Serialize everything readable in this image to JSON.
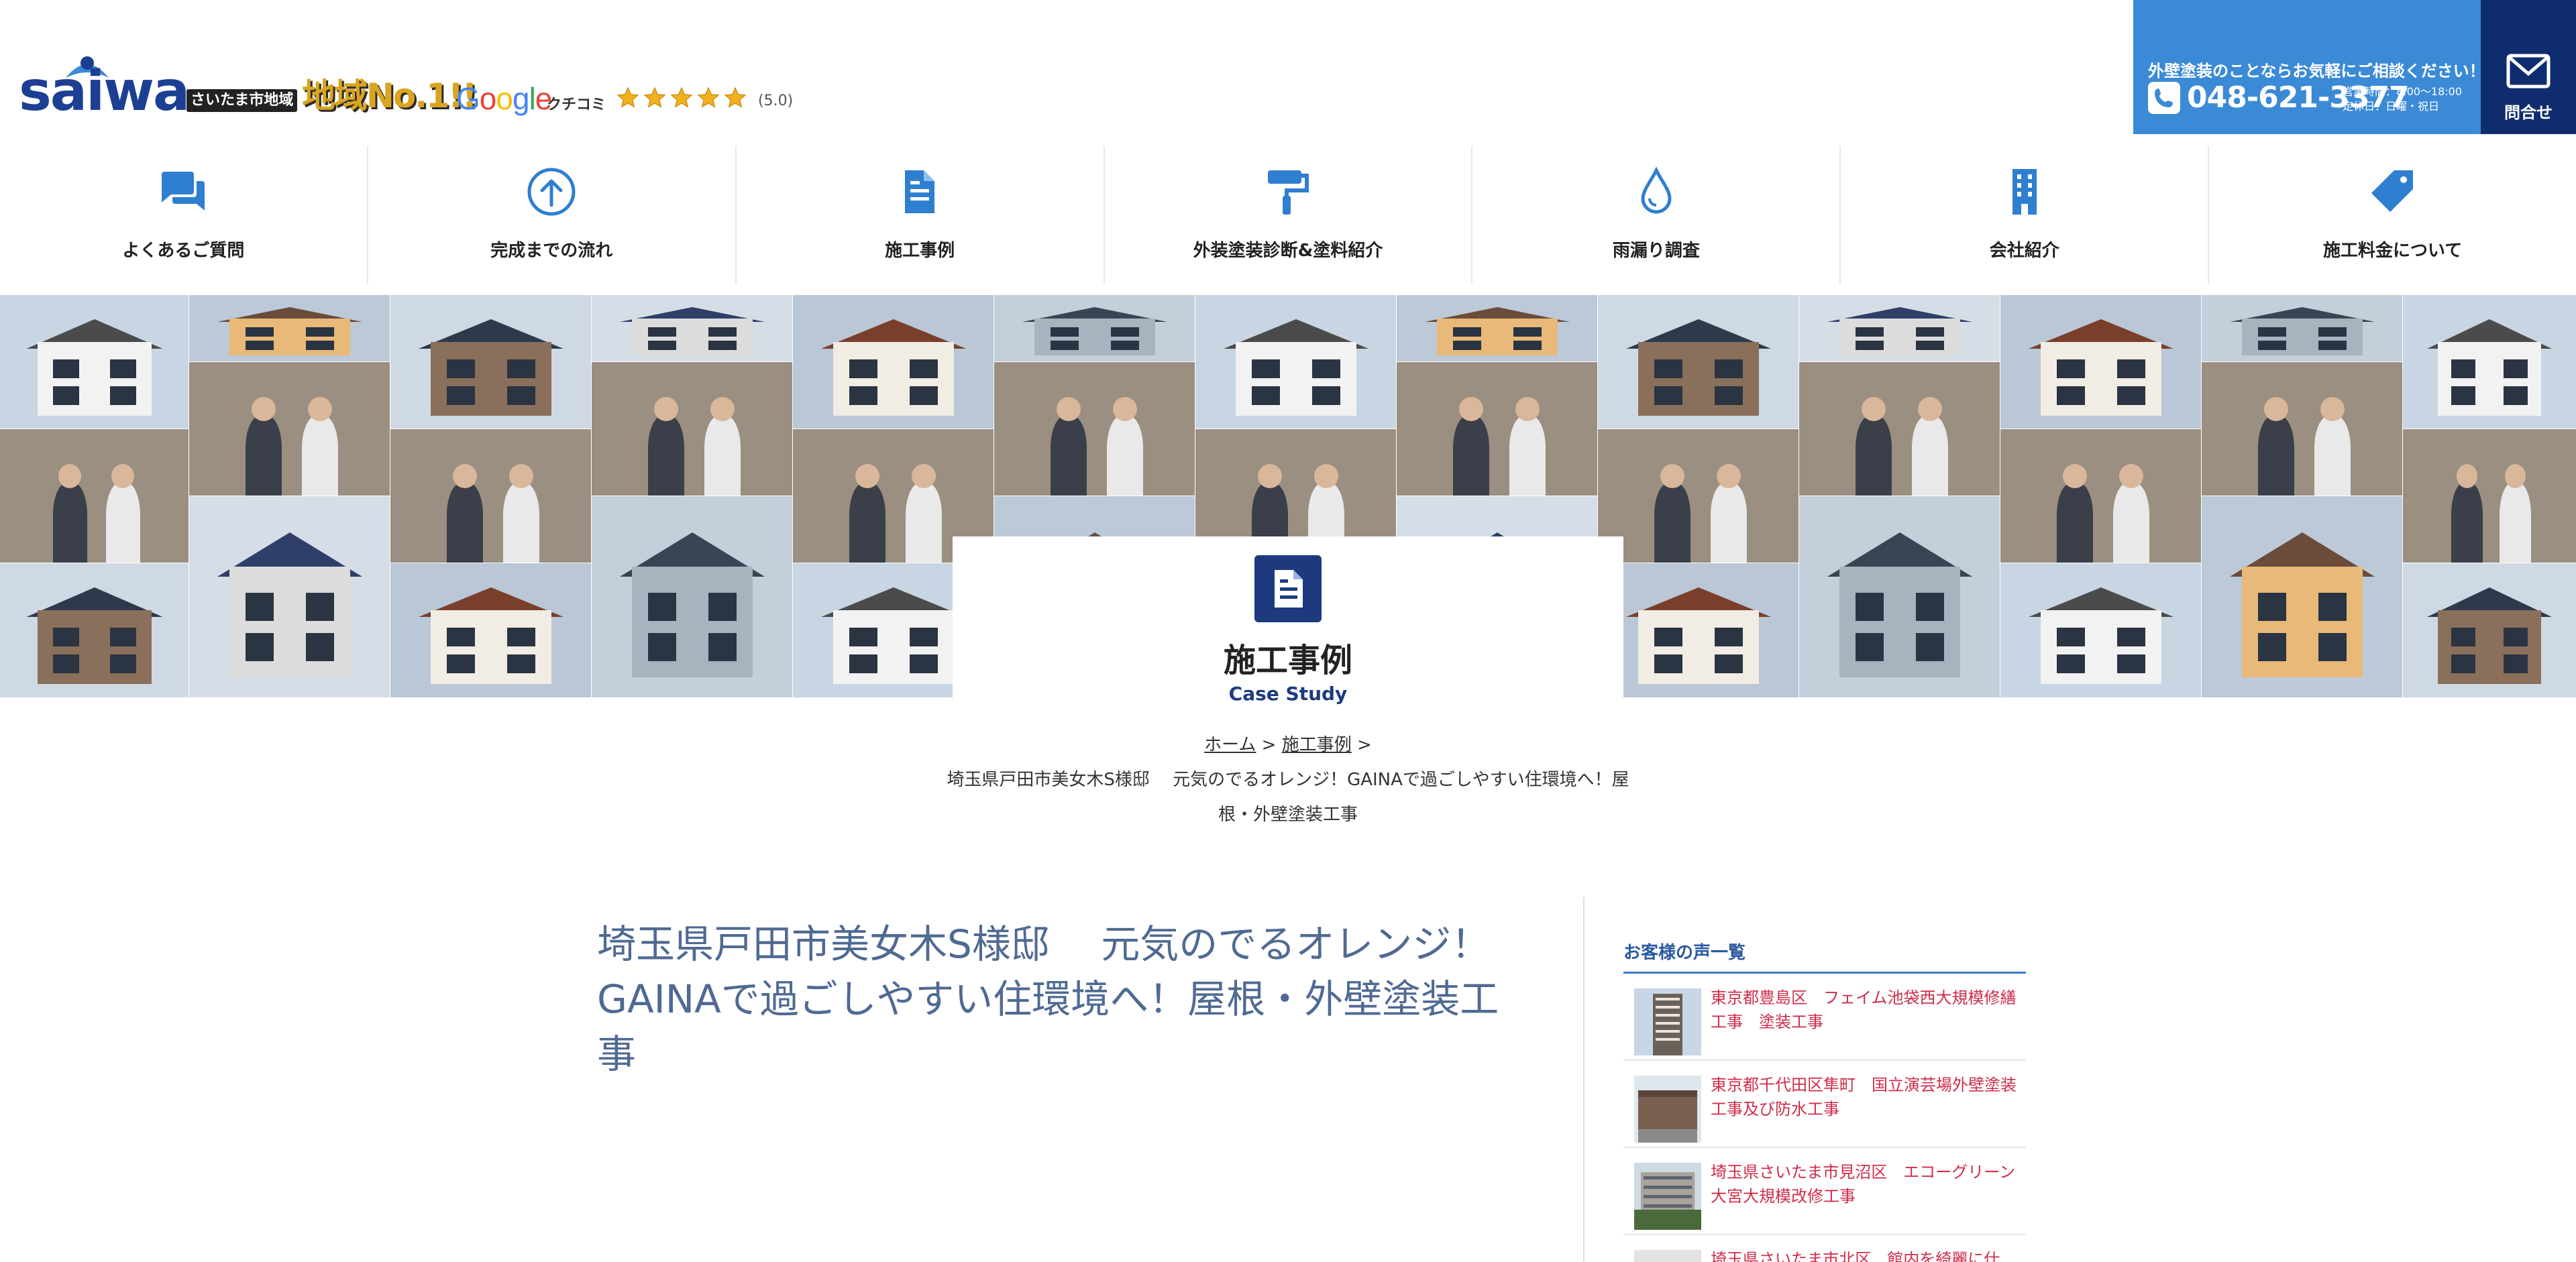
{
  "header": {
    "logo_text": "saiwa",
    "tagline_region": "さいたま市地域",
    "tagline_no1": "地域No.1!!",
    "google": "Google",
    "kuchikomi": "クチコミ",
    "rating_stars": 5,
    "rating_text": "(5.0)",
    "contact_lead": "外壁塗装のことならお気軽にご相談ください！",
    "phone": "048-621-3377",
    "hours_line1": "営業時間：8:00〜18:00",
    "hours_line2": "定休日：日曜・祝日",
    "mail_label": "問合せ"
  },
  "nav": {
    "items": [
      {
        "label": "よくあるご質問",
        "icon": "chat-icon"
      },
      {
        "label": "完成までの流れ",
        "icon": "arrow-up-circle-icon"
      },
      {
        "label": "施工事例",
        "icon": "document-icon"
      },
      {
        "label": "外装塗装診断&塗料紹介",
        "icon": "paint-roller-icon"
      },
      {
        "label": "雨漏り調査",
        "icon": "water-drop-icon"
      },
      {
        "label": "会社紹介",
        "icon": "building-icon"
      },
      {
        "label": "施工料金について",
        "icon": "price-tag-icon"
      }
    ]
  },
  "hero": {
    "title": "施工事例",
    "subtitle": "Case Study"
  },
  "breadcrumb": {
    "home": "ホーム",
    "section": "施工事例",
    "current": "埼玉県戸田市美女木S様邸　 元気のでるオレンジ！GAINAで過ごしやすい住環境へ！屋根・外壁塗装工事"
  },
  "main": {
    "title": "埼玉県戸田市美女木S様邸　 元気のでるオレンジ！GAINAで過ごしやすい住環境へ！屋根・外壁塗装工事"
  },
  "sidebar": {
    "heading": "お客様の声一覧",
    "items": [
      {
        "text": "東京都豊島区　フェイム池袋西大規模修繕工事　塗装工事"
      },
      {
        "text": "東京都千代田区隼町　国立演芸場外壁塗装工事及び防水工事"
      },
      {
        "text": "埼玉県さいたま市見沼区　エコーグリーン大宮大規模改修工事"
      },
      {
        "text": "埼玉県さいたま市北区　館内を綺麗に仕"
      }
    ]
  },
  "colors": {
    "brand_navy": "#1d3f93",
    "contact_blue": "#3b8ad6",
    "mail_navy": "#0f2d6e",
    "nav_icon_blue": "#2f7fd0",
    "title_blue": "#4f6a93",
    "link_red": "#cf2c4a"
  }
}
